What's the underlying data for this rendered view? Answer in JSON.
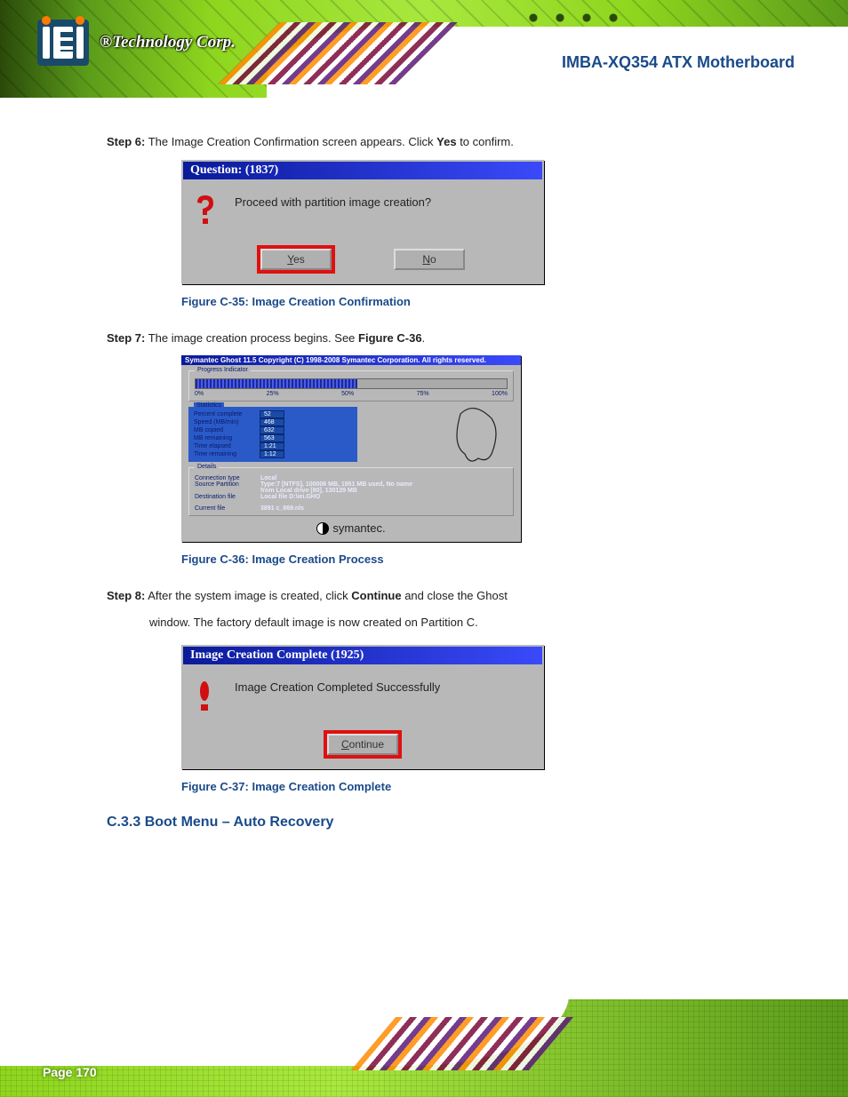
{
  "brand": {
    "logo_text": "®Technology Corp."
  },
  "doc_title": "IMBA-XQ354 ATX Motherboard",
  "step6": "Step 6: The Image Creation Confirmation screen appears. Click Yes to confirm.",
  "dialog1": {
    "title": "Question: (1837)",
    "message": "Proceed with partition image creation?",
    "yes": "Yes",
    "no": "No"
  },
  "fig35_caption": "Figure C-35: Image Creation Confirmation",
  "step7": "Step 7: The image creation process begins. See Figure C-36.",
  "ghost": {
    "title": "Symantec Ghost 11.5  Copyright (C) 1998-2008 Symantec Corporation. All rights reserved.",
    "group_progress": "Progress Indicator",
    "ticks": [
      "0%",
      "25%",
      "50%",
      "75%",
      "100%"
    ],
    "group_stats": "Statistics",
    "stats": {
      "percent_complete": {
        "label": "Percent complete",
        "value": "52"
      },
      "speed": {
        "label": "Speed (MB/min)",
        "value": "468"
      },
      "mb_copied": {
        "label": "MB copied",
        "value": "632"
      },
      "mb_remaining": {
        "label": "MB remaining",
        "value": "563"
      },
      "time_elapsed": {
        "label": "Time elapsed",
        "value": "1:21"
      },
      "time_remaining": {
        "label": "Time remaining",
        "value": "1:12"
      }
    },
    "group_details": "Details",
    "details": {
      "connection_type": {
        "label": "Connection type",
        "value": "Local"
      },
      "source_partition": {
        "label": "Source Partition",
        "value": "Type:7 [NTFS], 100006 MB, 1951 MB used, No name"
      },
      "source_partition2": "from Local drive [80], 130129 MB",
      "destination_file": {
        "label": "Destination file",
        "value": "Local file D:\\iei.GHO"
      },
      "current_file": {
        "label": "Current file",
        "value": "3891 c_869.nls"
      }
    },
    "brand": "symantec."
  },
  "chart_data": {
    "type": "bar",
    "title": "Ghost image-creation progress",
    "xlabel": "",
    "ylabel": "Percent complete",
    "ylim": [
      0,
      100
    ],
    "categories": [
      "progress"
    ],
    "values": [
      52
    ],
    "ticks": [
      0,
      25,
      50,
      75,
      100
    ]
  },
  "fig36_caption": "Figure C-36: Image Creation Process",
  "step8a": "Step 8: After the system image is created, click Continue and close the Ghost",
  "step8b": "window. The factory default image is now created on Partition C.",
  "dialog2": {
    "title": "Image Creation Complete (1925)",
    "message": "Image Creation Completed Successfully",
    "continue": "Continue"
  },
  "fig37_caption": "Figure C-37: Image Creation Complete",
  "section_heading": "C.3.3 Boot Menu – Auto Recovery",
  "page_number": "Page 170"
}
